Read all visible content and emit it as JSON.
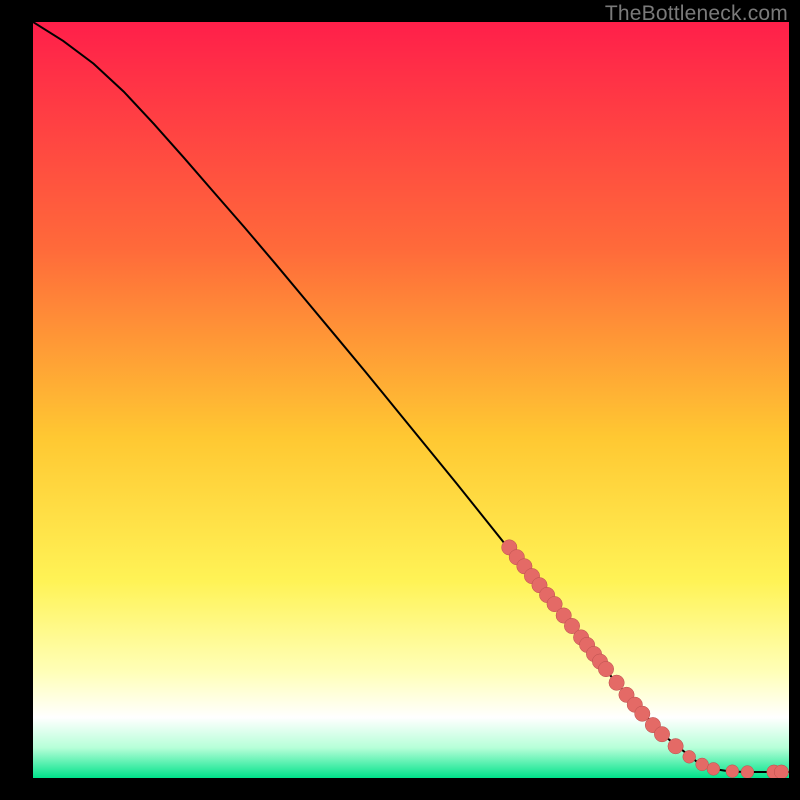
{
  "attribution": "TheBottleneck.com",
  "colors": {
    "top": "#ff1f4a",
    "mid_orange": "#ff8a3a",
    "yellow": "#ffe233",
    "pale_yellow": "#ffff9a",
    "white": "#ffffff",
    "green": "#00e28a",
    "curve": "#000000",
    "marker": "#e46a66",
    "marker_stroke": "#b94f4d"
  },
  "chart_data": {
    "type": "line",
    "title": "",
    "xlabel": "",
    "ylabel": "",
    "xlim": [
      0,
      100
    ],
    "ylim": [
      0,
      100
    ],
    "series": [
      {
        "name": "curve",
        "x": [
          0,
          4,
          8,
          12,
          16,
          20,
          24,
          28,
          32,
          36,
          40,
          44,
          48,
          52,
          56,
          60,
          64,
          68,
          72,
          76,
          80,
          84,
          88,
          90,
          92,
          94,
          96,
          98,
          100
        ],
        "y": [
          100,
          97.5,
          94.5,
          90.8,
          86.5,
          82.0,
          77.4,
          72.8,
          68.1,
          63.3,
          58.5,
          53.7,
          48.8,
          43.9,
          39.0,
          34.0,
          29.0,
          24.0,
          19.0,
          14.0,
          9.3,
          5.2,
          2.0,
          1.2,
          0.9,
          0.8,
          0.8,
          0.8,
          0.8
        ]
      }
    ],
    "markers": [
      {
        "x": 63.0,
        "y": 30.5,
        "r": 1.2
      },
      {
        "x": 64.0,
        "y": 29.2,
        "r": 1.2
      },
      {
        "x": 65.0,
        "y": 28.0,
        "r": 1.2
      },
      {
        "x": 66.0,
        "y": 26.7,
        "r": 1.2
      },
      {
        "x": 67.0,
        "y": 25.5,
        "r": 1.2
      },
      {
        "x": 68.0,
        "y": 24.2,
        "r": 1.2
      },
      {
        "x": 69.0,
        "y": 23.0,
        "r": 1.2
      },
      {
        "x": 70.2,
        "y": 21.5,
        "r": 1.2
      },
      {
        "x": 71.3,
        "y": 20.1,
        "r": 1.2
      },
      {
        "x": 72.5,
        "y": 18.6,
        "r": 1.2
      },
      {
        "x": 73.3,
        "y": 17.6,
        "r": 1.2
      },
      {
        "x": 74.2,
        "y": 16.4,
        "r": 1.2
      },
      {
        "x": 75.0,
        "y": 15.4,
        "r": 1.2
      },
      {
        "x": 75.8,
        "y": 14.4,
        "r": 1.2
      },
      {
        "x": 77.2,
        "y": 12.6,
        "r": 1.2
      },
      {
        "x": 78.5,
        "y": 11.0,
        "r": 1.2
      },
      {
        "x": 79.6,
        "y": 9.7,
        "r": 1.2
      },
      {
        "x": 80.6,
        "y": 8.5,
        "r": 1.2
      },
      {
        "x": 82.0,
        "y": 7.0,
        "r": 1.2
      },
      {
        "x": 83.2,
        "y": 5.8,
        "r": 1.2
      },
      {
        "x": 85.0,
        "y": 4.2,
        "r": 1.2
      },
      {
        "x": 86.8,
        "y": 2.8,
        "r": 1.0
      },
      {
        "x": 88.5,
        "y": 1.8,
        "r": 1.0
      },
      {
        "x": 90.0,
        "y": 1.2,
        "r": 1.0
      },
      {
        "x": 92.5,
        "y": 0.9,
        "r": 1.0
      },
      {
        "x": 94.5,
        "y": 0.8,
        "r": 1.0
      },
      {
        "x": 98.0,
        "y": 0.8,
        "r": 1.1
      },
      {
        "x": 99.0,
        "y": 0.8,
        "r": 1.1
      }
    ]
  }
}
